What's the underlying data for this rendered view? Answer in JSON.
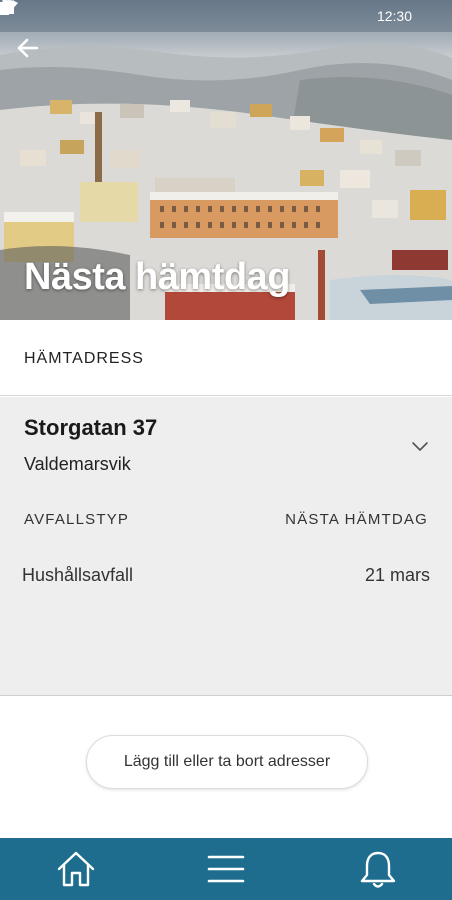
{
  "status_bar": {
    "time": "12:30",
    "icons": [
      "wifi-icon",
      "signal-icon",
      "battery-icon"
    ]
  },
  "header": {
    "title": "Nästa hämtdag",
    "back_icon": "arrow-left-icon"
  },
  "section": {
    "label": "HÄMTADRESS"
  },
  "address": {
    "street": "Storgatan 37",
    "city": "Valdemarsvik",
    "expand_icon": "chevron-down-icon",
    "columns": {
      "waste_type": "AVFALLSTYP",
      "next_pickup": "NÄSTA HÄMTDAG"
    },
    "rows": [
      {
        "waste_type": "Hushållsavfall",
        "date": "21 mars"
      }
    ]
  },
  "actions": {
    "manage_addresses": "Lägg till eller ta bort adresser"
  },
  "bottom_nav": {
    "items": [
      "home-icon",
      "menu-icon",
      "bell-icon"
    ]
  },
  "colors": {
    "nav_bar": "#1e6d8e",
    "card_background": "#eeeeee",
    "hero_title": "#ffffff"
  }
}
